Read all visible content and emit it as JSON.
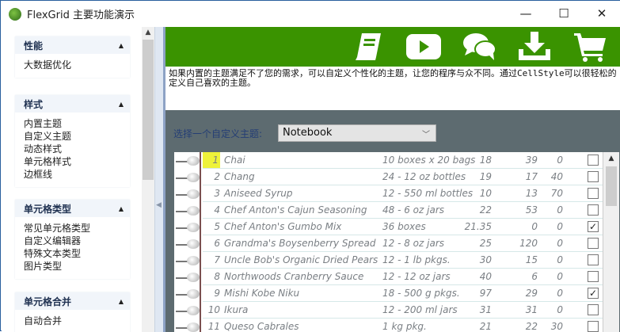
{
  "window": {
    "title": "FlexGrid 主要功能演示",
    "minimize": "—",
    "maximize": "☐",
    "close": "✕"
  },
  "sidebar": {
    "groups": [
      {
        "title": "性能",
        "items": [
          "大数据优化"
        ]
      },
      {
        "title": "样式",
        "items": [
          "内置主题",
          "自定义主题",
          "动态样式",
          "单元格样式",
          "边框线"
        ]
      },
      {
        "title": "单元格类型",
        "items": [
          "常见单元格类型",
          "自定义编辑器",
          "特殊文本类型",
          "图片类型"
        ]
      },
      {
        "title": "单元格合并",
        "items": [
          "自动合并"
        ]
      }
    ]
  },
  "banner": {
    "icons": [
      "book-icon",
      "play-icon",
      "chat-icon",
      "download-icon",
      "cart-icon"
    ]
  },
  "description": "如果内置的主题满足不了您的需求，可以自定义个性化的主题，让您的程序与众不同。通过CellStyle可以很轻松的定义自己喜欢的主题。",
  "theme_label": "选择一个自定义主题:",
  "theme_value": "Notebook",
  "rows": [
    {
      "id": "1",
      "name": "Chai",
      "pack": "10 boxes x 20 bags",
      "price": "18",
      "stock": "39",
      "order": "0",
      "chk": ""
    },
    {
      "id": "2",
      "name": "Chang",
      "pack": "24 - 12 oz bottles",
      "price": "19",
      "stock": "17",
      "order": "40",
      "chk": ""
    },
    {
      "id": "3",
      "name": "Aniseed Syrup",
      "pack": "12 - 550 ml bottles",
      "price": "10",
      "stock": "13",
      "order": "70",
      "chk": ""
    },
    {
      "id": "4",
      "name": "Chef Anton's Cajun Seasoning",
      "pack": "48 - 6 oz jars",
      "price": "22",
      "stock": "53",
      "order": "0",
      "chk": ""
    },
    {
      "id": "5",
      "name": "Chef Anton's Gumbo Mix",
      "pack": "36 boxes",
      "price": "21.35",
      "stock": "0",
      "order": "0",
      "chk": "✓"
    },
    {
      "id": "6",
      "name": "Grandma's Boysenberry Spread",
      "pack": "12 - 8 oz jars",
      "price": "25",
      "stock": "120",
      "order": "0",
      "chk": ""
    },
    {
      "id": "7",
      "name": "Uncle Bob's Organic Dried Pears",
      "pack": "12 - 1 lb pkgs.",
      "price": "30",
      "stock": "15",
      "order": "0",
      "chk": ""
    },
    {
      "id": "8",
      "name": "Northwoods Cranberry Sauce",
      "pack": "12 - 12 oz jars",
      "price": "40",
      "stock": "6",
      "order": "0",
      "chk": ""
    },
    {
      "id": "9",
      "name": "Mishi Kobe Niku",
      "pack": "18 - 500 g pkgs.",
      "price": "97",
      "stock": "29",
      "order": "0",
      "chk": "✓"
    },
    {
      "id": "10",
      "name": "Ikura",
      "pack": "12 - 200 ml jars",
      "price": "31",
      "stock": "31",
      "order": "0",
      "chk": ""
    },
    {
      "id": "11",
      "name": "Queso Cabrales",
      "pack": "1 kg pkg.",
      "price": "21",
      "stock": "22",
      "order": "30",
      "chk": ""
    }
  ]
}
